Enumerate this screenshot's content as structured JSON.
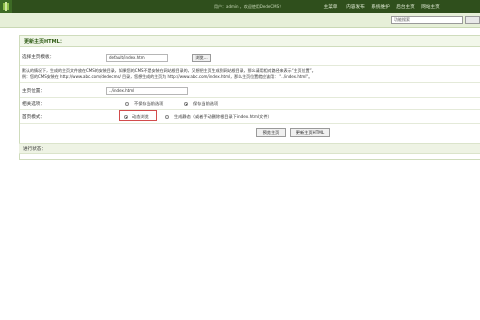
{
  "header": {
    "user_info": "用户：admin ，欢迎使用DedeCMS！",
    "nav": [
      "主菜单",
      "内容发布",
      "系统维护",
      "后台主页",
      "网站主页"
    ]
  },
  "search": {
    "placeholder": "功能搜索"
  },
  "panel": {
    "title": "更新主页HTML：",
    "template_label": "选择主页模板：",
    "template_value": "default/index.htm",
    "browse_label": "浏览...",
    "note_line1": "默认的情况下，生成的主页文件放在CMS的安装目录，如果您的CMS不是安装在网站根目录的，又想把主页生成到网站根目录，那么请用相对路径来表示“主页位置”。",
    "note_line2": "例：您的CMS安装在 http://www.abc.com/dedecms/ 目录，您想生成的主页为 http://www.abc.com/index.html，那么主页位置就应该用： \"../index.html\"。",
    "page_label": "主页位置：",
    "page_value": "../index.html",
    "option_label": "相关选项：",
    "option_no_save": "不保存当前选项",
    "option_save": "保存当前选项",
    "mode_label": "首页模式：",
    "mode_dynamic": "动态浏览",
    "mode_static": "生成静态（或者手动删除根目录下index.html文件）",
    "preview_button": "预览主页",
    "update_button": "更新主页HTML"
  },
  "progress": {
    "label": "进行状态："
  }
}
